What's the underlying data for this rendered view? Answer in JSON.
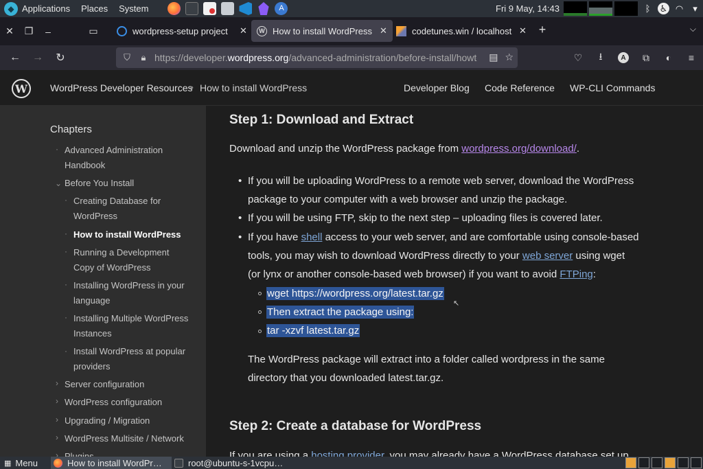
{
  "os_panel": {
    "menu_items": [
      "Applications",
      "Places",
      "System"
    ],
    "clock": "Fri  9 May, 14:43",
    "launchers": [
      "firefox-icon",
      "terminal-icon",
      "text-editor-icon",
      "file-manager-icon",
      "vscode-icon",
      "obsidian-icon",
      "app-icon"
    ]
  },
  "tabs": [
    {
      "title": "wordpress-setup project",
      "favicon": "sync-icon",
      "active": false
    },
    {
      "title": "How to install WordPress",
      "favicon": "wordpress-icon",
      "active": true
    },
    {
      "title": "codetunes.win / localhost",
      "favicon": "phpmyadmin-icon",
      "active": false
    }
  ],
  "url": {
    "prefix": "https://developer.",
    "host": "wordpress.org",
    "path": "/advanced-administration/before-install/howto-install/"
  },
  "site_header": {
    "site_name": "WordPress Developer Resources",
    "separator": "•",
    "breadcrumb": "How to install WordPress",
    "nav": [
      "Developer Blog",
      "Code Reference",
      "WP-CLI Commands"
    ]
  },
  "sidebar": {
    "heading": "Chapters",
    "items": [
      {
        "label": "Advanced Administration Handbook"
      },
      {
        "label": "Before You Install"
      },
      {
        "label": "Creating Database for WordPress"
      },
      {
        "label": "How to install WordPress"
      },
      {
        "label": "Running a Development Copy of WordPress"
      },
      {
        "label": "Installing WordPress in your language"
      },
      {
        "label": "Installing Multiple WordPress Instances"
      },
      {
        "label": "Install WordPress at popular providers"
      },
      {
        "label": "Server configuration"
      },
      {
        "label": "WordPress configuration"
      },
      {
        "label": "Upgrading / Migration"
      },
      {
        "label": "WordPress Multisite / Network"
      },
      {
        "label": "Plugins"
      }
    ]
  },
  "content": {
    "step1_title": "Step 1: Download and Extract",
    "intro_text": "Download and unzip the WordPress package from ",
    "intro_link": "wordpress.org/download/",
    "intro_end": ".",
    "bullet1_line1": "If you will be uploading WordPress to a remote web server, download the WordPress",
    "bullet1_line2": "package to your computer with a web browser and unzip the package.",
    "bullet2": "If you will be using FTP, skip to the next step – uploading files is covered later.",
    "bullet3_a": "If you have ",
    "bullet3_link1": "shell",
    "bullet3_b": " access to your web server, and are comfortable using console-based",
    "bullet3_c": "tools, you may wish to download WordPress directly to your ",
    "bullet3_link2": "web server",
    "bullet3_d": " using wget",
    "bullet3_e": "(or lynx or another console-based web browser) if you want to avoid ",
    "bullet3_link3": "FTPing",
    "bullet3_f": ":",
    "sub_items": [
      "wget https://wordpress.org/latest.tar.gz",
      "Then extract the package using:",
      "tar -xzvf latest.tar.gz"
    ],
    "extract_line1": "The WordPress package will extract into a folder called wordpress in the same",
    "extract_line2": "directory that you downloaded latest.tar.gz.",
    "step2_title": "Step 2: Create a database for WordPress",
    "step2_a": "If you are using a ",
    "step2_link": "hosting provider",
    "step2_b": ", you may already have a WordPress database set up"
  },
  "taskbar": {
    "menu": "Menu",
    "items": [
      "How to install WordPr…",
      "root@ubuntu-s-1vcpu…"
    ]
  },
  "colors": {
    "link": "#7fa7d8",
    "visited_link": "#b787ea",
    "selection": "#2e5597",
    "sidebar_bg": "#2e2e2e",
    "page_bg": "#1e1e1e"
  }
}
